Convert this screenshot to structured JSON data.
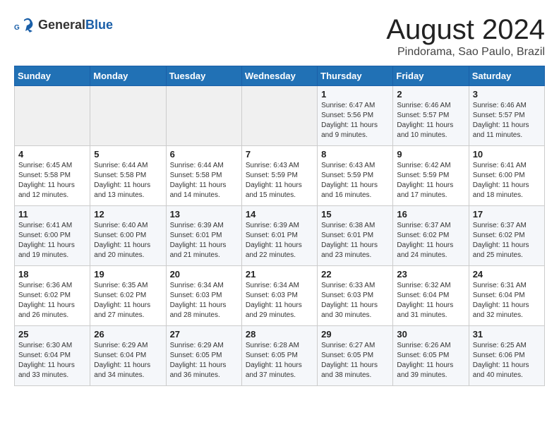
{
  "logo": {
    "text_general": "General",
    "text_blue": "Blue"
  },
  "title": "August 2024",
  "subtitle": "Pindorama, Sao Paulo, Brazil",
  "days_of_week": [
    "Sunday",
    "Monday",
    "Tuesday",
    "Wednesday",
    "Thursday",
    "Friday",
    "Saturday"
  ],
  "weeks": [
    [
      {
        "day": "",
        "info": ""
      },
      {
        "day": "",
        "info": ""
      },
      {
        "day": "",
        "info": ""
      },
      {
        "day": "",
        "info": ""
      },
      {
        "day": "1",
        "info": "Sunrise: 6:47 AM\nSunset: 5:56 PM\nDaylight: 11 hours and 9 minutes."
      },
      {
        "day": "2",
        "info": "Sunrise: 6:46 AM\nSunset: 5:57 PM\nDaylight: 11 hours and 10 minutes."
      },
      {
        "day": "3",
        "info": "Sunrise: 6:46 AM\nSunset: 5:57 PM\nDaylight: 11 hours and 11 minutes."
      }
    ],
    [
      {
        "day": "4",
        "info": "Sunrise: 6:45 AM\nSunset: 5:58 PM\nDaylight: 11 hours and 12 minutes."
      },
      {
        "day": "5",
        "info": "Sunrise: 6:44 AM\nSunset: 5:58 PM\nDaylight: 11 hours and 13 minutes."
      },
      {
        "day": "6",
        "info": "Sunrise: 6:44 AM\nSunset: 5:58 PM\nDaylight: 11 hours and 14 minutes."
      },
      {
        "day": "7",
        "info": "Sunrise: 6:43 AM\nSunset: 5:59 PM\nDaylight: 11 hours and 15 minutes."
      },
      {
        "day": "8",
        "info": "Sunrise: 6:43 AM\nSunset: 5:59 PM\nDaylight: 11 hours and 16 minutes."
      },
      {
        "day": "9",
        "info": "Sunrise: 6:42 AM\nSunset: 5:59 PM\nDaylight: 11 hours and 17 minutes."
      },
      {
        "day": "10",
        "info": "Sunrise: 6:41 AM\nSunset: 6:00 PM\nDaylight: 11 hours and 18 minutes."
      }
    ],
    [
      {
        "day": "11",
        "info": "Sunrise: 6:41 AM\nSunset: 6:00 PM\nDaylight: 11 hours and 19 minutes."
      },
      {
        "day": "12",
        "info": "Sunrise: 6:40 AM\nSunset: 6:00 PM\nDaylight: 11 hours and 20 minutes."
      },
      {
        "day": "13",
        "info": "Sunrise: 6:39 AM\nSunset: 6:01 PM\nDaylight: 11 hours and 21 minutes."
      },
      {
        "day": "14",
        "info": "Sunrise: 6:39 AM\nSunset: 6:01 PM\nDaylight: 11 hours and 22 minutes."
      },
      {
        "day": "15",
        "info": "Sunrise: 6:38 AM\nSunset: 6:01 PM\nDaylight: 11 hours and 23 minutes."
      },
      {
        "day": "16",
        "info": "Sunrise: 6:37 AM\nSunset: 6:02 PM\nDaylight: 11 hours and 24 minutes."
      },
      {
        "day": "17",
        "info": "Sunrise: 6:37 AM\nSunset: 6:02 PM\nDaylight: 11 hours and 25 minutes."
      }
    ],
    [
      {
        "day": "18",
        "info": "Sunrise: 6:36 AM\nSunset: 6:02 PM\nDaylight: 11 hours and 26 minutes."
      },
      {
        "day": "19",
        "info": "Sunrise: 6:35 AM\nSunset: 6:02 PM\nDaylight: 11 hours and 27 minutes."
      },
      {
        "day": "20",
        "info": "Sunrise: 6:34 AM\nSunset: 6:03 PM\nDaylight: 11 hours and 28 minutes."
      },
      {
        "day": "21",
        "info": "Sunrise: 6:34 AM\nSunset: 6:03 PM\nDaylight: 11 hours and 29 minutes."
      },
      {
        "day": "22",
        "info": "Sunrise: 6:33 AM\nSunset: 6:03 PM\nDaylight: 11 hours and 30 minutes."
      },
      {
        "day": "23",
        "info": "Sunrise: 6:32 AM\nSunset: 6:04 PM\nDaylight: 11 hours and 31 minutes."
      },
      {
        "day": "24",
        "info": "Sunrise: 6:31 AM\nSunset: 6:04 PM\nDaylight: 11 hours and 32 minutes."
      }
    ],
    [
      {
        "day": "25",
        "info": "Sunrise: 6:30 AM\nSunset: 6:04 PM\nDaylight: 11 hours and 33 minutes."
      },
      {
        "day": "26",
        "info": "Sunrise: 6:29 AM\nSunset: 6:04 PM\nDaylight: 11 hours and 34 minutes."
      },
      {
        "day": "27",
        "info": "Sunrise: 6:29 AM\nSunset: 6:05 PM\nDaylight: 11 hours and 36 minutes."
      },
      {
        "day": "28",
        "info": "Sunrise: 6:28 AM\nSunset: 6:05 PM\nDaylight: 11 hours and 37 minutes."
      },
      {
        "day": "29",
        "info": "Sunrise: 6:27 AM\nSunset: 6:05 PM\nDaylight: 11 hours and 38 minutes."
      },
      {
        "day": "30",
        "info": "Sunrise: 6:26 AM\nSunset: 6:05 PM\nDaylight: 11 hours and 39 minutes."
      },
      {
        "day": "31",
        "info": "Sunrise: 6:25 AM\nSunset: 6:06 PM\nDaylight: 11 hours and 40 minutes."
      }
    ]
  ],
  "colors": {
    "header_bg": "#2171b5",
    "header_text": "#ffffff",
    "odd_row_bg": "#f5f7fa",
    "even_row_bg": "#ffffff",
    "empty_bg": "#f0f0f0"
  }
}
